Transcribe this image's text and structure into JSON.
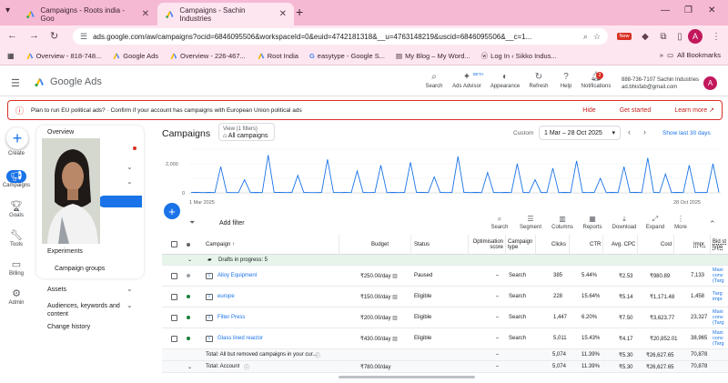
{
  "browser": {
    "tabs": [
      {
        "title": "Campaigns - Roots india - Goo"
      },
      {
        "title": "Campaigns - Sachin Industries"
      }
    ],
    "url": "ads.google.com/aw/campaigns?ocid=6846095506&workspaceId=0&euid=4742181318&__u=4763148219&uscid=6846095506&__c=1...",
    "bookmarks": [
      {
        "label": "Overview - 818-748..."
      },
      {
        "label": "Google Ads"
      },
      {
        "label": "Overview - 226-467..."
      },
      {
        "label": "Root India"
      },
      {
        "label": "easytype - Google S..."
      },
      {
        "label": "My Blog – My Word..."
      },
      {
        "label": "Log In ‹ Sikko Indus..."
      }
    ],
    "all_bookmarks": "All Bookmarks",
    "avatar_letter": "A",
    "new_badge": "New"
  },
  "header": {
    "product": "Google Ads",
    "icons": [
      {
        "label": "Search"
      },
      {
        "label": "Ads Advisor"
      },
      {
        "label": "Appearance"
      },
      {
        "label": "Refresh"
      },
      {
        "label": "Help"
      },
      {
        "label": "Notifications"
      }
    ],
    "beta": "BETA",
    "notif_count": "2",
    "account_id": "888-736-7107 Sachin Industries",
    "account_email": "ad.bhisfab@gmail.com",
    "avatar_letter": "A"
  },
  "banner": {
    "text": "Plan to run EU political ads? · Confirm if your account has campaigns with European Union political ads",
    "hide": "Hide",
    "get_started": "Get started",
    "learn_more": "Learn more"
  },
  "rail": [
    {
      "label": "Create"
    },
    {
      "label": "Campaigns"
    },
    {
      "label": "Goals"
    },
    {
      "label": "Tools"
    },
    {
      "label": "Billing"
    },
    {
      "label": "Admin"
    }
  ],
  "sidenav": {
    "overview": "Overview",
    "experiments": "Experiments",
    "campaign_groups": "Campaign groups",
    "assets": "Assets",
    "audiences": "Audiences, keywords and content",
    "change_history": "Change history"
  },
  "main": {
    "title": "Campaigns",
    "view_label": "View (1 filters)",
    "view_value": "All campaigns",
    "custom": "Custom",
    "date_range": "1 Mar – 28 Oct 2025",
    "last30": "Show last 30 days",
    "add_filter": "Add filter",
    "toolbar": [
      {
        "label": "Search"
      },
      {
        "label": "Segment"
      },
      {
        "label": "Columns"
      },
      {
        "label": "Reports"
      },
      {
        "label": "Download"
      },
      {
        "label": "Expand"
      },
      {
        "label": "More"
      }
    ]
  },
  "chart_data": {
    "type": "line",
    "y_ticks": [
      "2,000",
      "0"
    ],
    "x_start": "1 Mar 2025",
    "x_end": "28 Oct 2025",
    "ylim": [
      0,
      3000
    ],
    "line_color": "#1a73e8",
    "values": [
      40,
      30,
      20,
      30,
      20,
      1800,
      30,
      20,
      20,
      900,
      20,
      30,
      20,
      2600,
      40,
      30,
      20,
      30,
      1200,
      30,
      20,
      20,
      30,
      2300,
      40,
      20,
      30,
      20,
      1500,
      30,
      20,
      30,
      1900,
      20,
      30,
      20,
      30,
      2100,
      40,
      30,
      20,
      1100,
      30,
      20,
      30,
      2500,
      30,
      20,
      30,
      20,
      1400,
      30,
      20,
      30,
      20,
      2000,
      30,
      20,
      900,
      30,
      20,
      1700,
      20,
      30,
      20,
      2200,
      30,
      20,
      30,
      1000,
      20,
      30,
      20,
      1800,
      40,
      30,
      20,
      2400,
      30,
      20,
      1300,
      20,
      30,
      20,
      1900,
      30,
      20,
      30,
      2000,
      40
    ]
  },
  "table": {
    "headers": {
      "campaign": "Campaign",
      "budget": "Budget",
      "status": "Status",
      "opt": "Optimisation score",
      "ctype": "Campaign type",
      "clicks": "Clicks",
      "ctr": "CTR",
      "cpc": "Avg. CPC",
      "cost": "Cost",
      "impr": "Impr.",
      "bid": "Bid st type"
    },
    "drafts": "Drafts in progress: 5",
    "rows": [
      {
        "dot": "#9aa0a6",
        "name": "Alloy Equipment",
        "budget": "₹250.00/day",
        "status": "Paused",
        "opt": "–",
        "ctype": "Search",
        "clicks": "385",
        "ctr": "5.44%",
        "cpc": "₹2.53",
        "cost": "₹980.89",
        "impr": "7,133",
        "bid": "Maxi conv (Targ"
      },
      {
        "dot": "#188038",
        "name": "europe",
        "budget": "₹150.00/day",
        "status": "Eligible",
        "opt": "–",
        "ctype": "Search",
        "clicks": "228",
        "ctr": "15.64%",
        "cpc": "₹5.14",
        "cost": "₹1,171.48",
        "impr": "1,458",
        "bid": "Targ impr"
      },
      {
        "dot": "#188038",
        "name": "Filter Press",
        "budget": "₹200.00/day",
        "status": "Eligible",
        "opt": "–",
        "ctype": "Search",
        "clicks": "1,447",
        "ctr": "6.20%",
        "cpc": "₹7.50",
        "cost": "₹3,623.77",
        "impr": "23,327",
        "bid": "Maxi conv (Targ"
      },
      {
        "dot": "#188038",
        "name": "Glass lined reactor",
        "budget": "₹430.00/day",
        "status": "Eligible",
        "opt": "–",
        "ctype": "Search",
        "clicks": "5,011",
        "ctr": "15.43%",
        "cpc": "₹4.17",
        "cost": "₹20,852.01",
        "impr": "38,965",
        "bid": "Maxi conv (Targ"
      }
    ],
    "total_removed": {
      "label": "Total: All but removed campaigns in your cur...",
      "opt": "–",
      "clicks": "5,074",
      "ctr": "11.39%",
      "cpc": "₹5.30",
      "cost": "₹26,627.65",
      "impr": "70,878"
    },
    "total_account": {
      "label": "Total: Account",
      "budget": "₹780.00/day",
      "opt": "–",
      "clicks": "5,074",
      "ctr": "11.39%",
      "cpc": "₹5.30",
      "cost": "₹26,627.65",
      "impr": "70,878"
    }
  }
}
